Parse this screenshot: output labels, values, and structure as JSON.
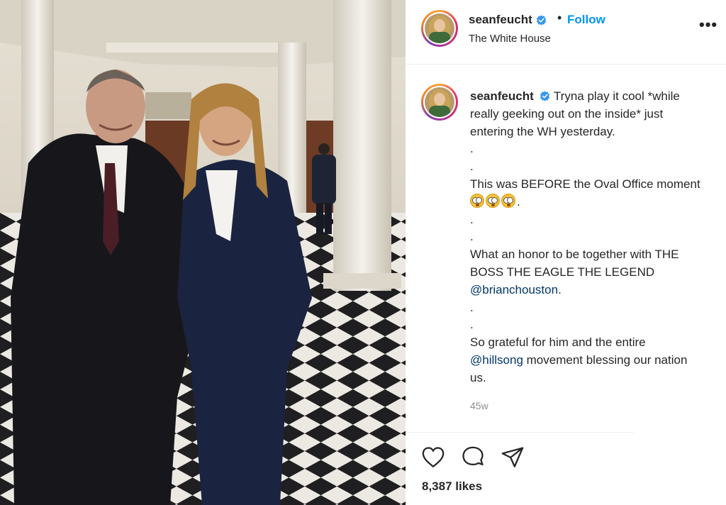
{
  "post": {
    "username": "seanfeucht",
    "verified": true,
    "follow_label": "Follow",
    "separator": "•",
    "location": "The White House",
    "more_label": "•••",
    "caption": {
      "username": "seanfeucht",
      "line1": " Tryna play it cool *while",
      "line2": "really geeking out on the inside* just",
      "line3": "entering the WH yesterday.",
      "dot1": ".",
      "dot2": ".",
      "line4": "This was BEFORE the Oval Office moment",
      "line5_suffix": ".",
      "emoji": "flushed-face",
      "dot3": ".",
      "dot4": ".",
      "line6": "What an honor to be together with THE",
      "line7": "BOSS THE EAGLE THE LEGEND",
      "mention1": "@brianchouston",
      "mention1_suffix": ".",
      "dot5": ".",
      "dot6": ".",
      "line8": "So grateful for him and the entire",
      "mention2": "@hillsong",
      "line9_suffix": " movement blessing our nation",
      "line10": "us."
    },
    "timestamp": "45w",
    "likes": "8,387 likes"
  },
  "icons": {
    "like": "heart-icon",
    "comment": "comment-bubble-icon",
    "share": "paper-plane-icon",
    "verified": "verified-badge-icon",
    "more": "more-options-icon"
  },
  "colors": {
    "follow_blue": "#0095f6",
    "mention_blue": "#00376b",
    "verified_blue": "#3897f0",
    "muted_gray": "#8e8e8e"
  }
}
